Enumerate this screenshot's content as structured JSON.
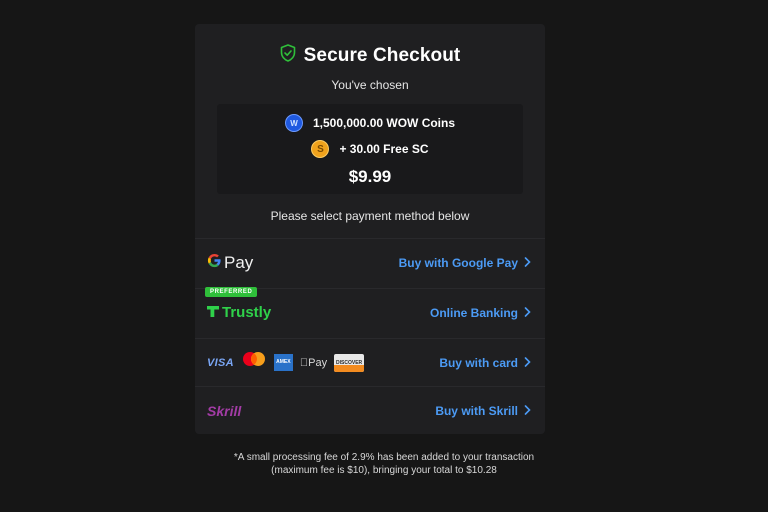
{
  "header": {
    "title": "Secure Checkout",
    "subtitle": "You've chosen"
  },
  "summary": {
    "coins_label": "1,500,000.00 WOW Coins",
    "bonus_label": "+ 30.00 Free SC",
    "price": "$9.99",
    "wow_badge": "W",
    "sc_badge": "S"
  },
  "instruction": "Please select payment method below",
  "payment_methods": [
    {
      "brand": "G Pay",
      "brand_parts": [
        "G",
        "Pay"
      ],
      "action": "Buy with Google Pay"
    },
    {
      "brand": "Trustly",
      "badge": "PREFERRED",
      "action": "Online Banking"
    },
    {
      "brand_logos": {
        "visa": "VISA",
        "amex": "AMEX",
        "applepay": "Pay",
        "discover": "DISCOVER"
      },
      "action": "Buy with card"
    },
    {
      "brand": "Skrill",
      "action": "Buy with Skrill"
    }
  ],
  "footnote_line1": "*A small processing fee of 2.9% has been added to your transaction",
  "footnote_line2": "(maximum fee is $10), bringing your total to $10.28",
  "colors": {
    "background": "#161616",
    "card": "#1f1f21",
    "link": "#4c9bf5",
    "shield": "#2fbf3a",
    "trustly": "#2fd14a",
    "skrill": "#a33ca6",
    "wow_blue": "#1f59e0",
    "sc_gold": "#f0a21c"
  }
}
